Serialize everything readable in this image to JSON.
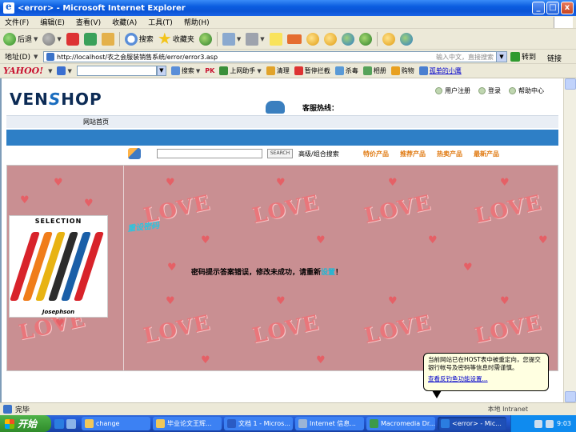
{
  "window": {
    "title": "<error> - Microsoft Internet Explorer",
    "min": "_",
    "max": "□",
    "close": "x"
  },
  "menu": [
    "文件(F)",
    "编辑(E)",
    "查看(V)",
    "收藏(A)",
    "工具(T)",
    "帮助(H)"
  ],
  "toolbar": {
    "back": "后退",
    "search": "搜索",
    "favorites": "收藏夹",
    "xml": "XML"
  },
  "address": {
    "label": "地址(D)",
    "url": "http://localhost/衣之会服装销售系统/error/error3.asp",
    "hint": "输入中文，直接搜索",
    "go": "转到",
    "links": "链接"
  },
  "yahoo": {
    "logo": "YAHOO!",
    "search": "搜索",
    "pk": "PK",
    "items": [
      "上网助手",
      "清理",
      "暂停拦截",
      "杀毒",
      "相册",
      "购物"
    ],
    "user_link": "孤单的小鹰"
  },
  "site": {
    "logo_a": "VEN",
    "logo_s": "S",
    "logo_b": "HOP",
    "hotline": "客服热线：",
    "toplinks": [
      "用户注册",
      "登录",
      "帮助中心"
    ],
    "nav_home": "网站首页",
    "search_btn": "SEARCH",
    "adv_search": "高级/组合搜索",
    "categories": [
      "特价产品",
      "推荐产品",
      "热卖产品",
      "最新产品"
    ],
    "love": "LOVE",
    "heading": "重设密码",
    "msg_before": "密码提示答案错误，修改未成功，请重新",
    "msg_link": "设置",
    "msg_after": "！",
    "ad_title": "SELECTION",
    "ad_brand": "Josephson",
    "band_colors": [
      "#d8232a",
      "#f07d1a",
      "#e8b313",
      "#2c2c2c",
      "#1a5fa8",
      "#d8232a"
    ]
  },
  "status": {
    "text": "完毕",
    "zone": "本地 Intranet"
  },
  "balloon": {
    "text": "当前网站已在HOST表中被重定向，您提交银行帐号及密码等信息时需谨慎。",
    "link": "查看反钓鱼功能设置..."
  },
  "taskbar": {
    "start": "开始",
    "tasks": [
      "change",
      "毕业论文王辉...",
      "文档 1 - Micros...",
      "Internet 信息...",
      "Macromedia Dr...",
      "<error> - Mic..."
    ],
    "time": "9:03"
  }
}
